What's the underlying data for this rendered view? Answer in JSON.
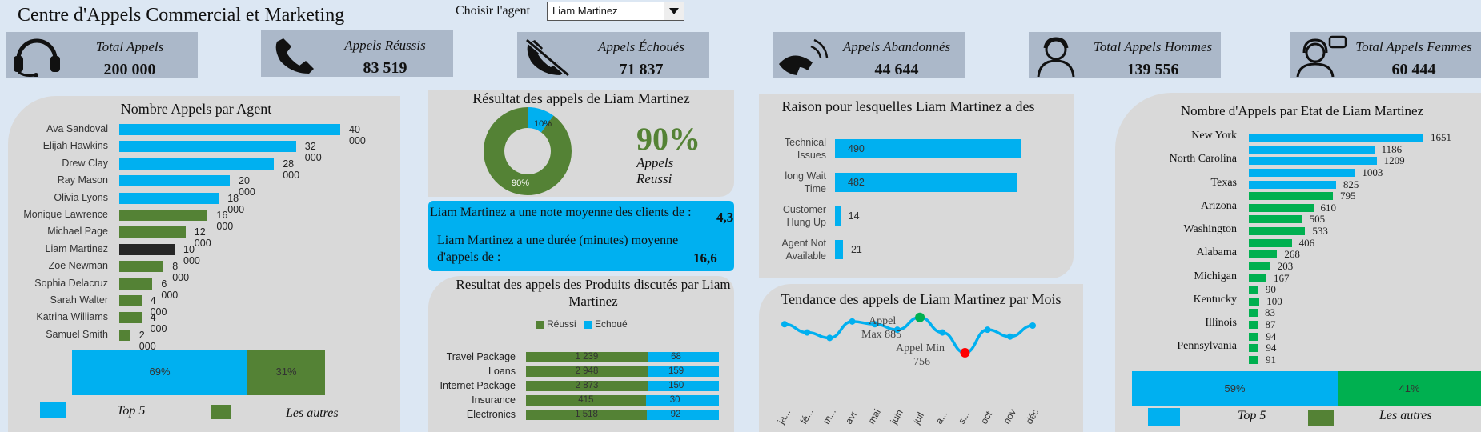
{
  "header": {
    "title": "Centre d'Appels Commercial et Marketing",
    "agent_label": "Choisir l'agent",
    "agent_value": "Liam Martinez"
  },
  "kpis": [
    {
      "label": "Total Appels",
      "value": "200 000",
      "icon": "headset-icon"
    },
    {
      "label": "Appels Réussis",
      "value": "83 519",
      "icon": "phone-icon"
    },
    {
      "label": "Appels Échoués",
      "value": "71 837",
      "icon": "phone-crossed-icon"
    },
    {
      "label": "Appels Abandonnés",
      "value": "44 644",
      "icon": "phone-ringing-icon"
    },
    {
      "label": "Total Appels Hommes",
      "value": "139 556",
      "icon": "male-user-icon"
    },
    {
      "label": "Total Appels Femmes",
      "value": "60 444",
      "icon": "female-agent-icon"
    }
  ],
  "colors": {
    "blue": "#00b0f0",
    "green": "#548235",
    "bright_green": "#00b050",
    "black": "#262626",
    "panel": "#d9d9d9",
    "kpi": "#abb8c9",
    "background": "#dce7f3",
    "min_marker": "#ff0000",
    "max_marker": "#00b050"
  },
  "summary": {
    "rating_text": "Liam Martinez a une note moyenne des clients de :",
    "rating_value": "4,3",
    "duration_text": "Liam Martinez a une durée (minutes) moyenne d'appels de :",
    "duration_value": "16,6"
  },
  "chart_data": [
    {
      "type": "bar",
      "orientation": "horizontal",
      "title": "Nombre Appels par Agent",
      "categories": [
        "Ava Sandoval",
        "Elijah Hawkins",
        "Drew Clay",
        "Ray Mason",
        "Olivia Lyons",
        "Monique Lawrence",
        "Michael Page",
        "Liam Martinez",
        "Zoe Newman",
        "Sophia Delacruz",
        "Sarah Walter",
        "Katrina Williams",
        "Samuel Smith"
      ],
      "values": [
        40000,
        32000,
        28000,
        20000,
        18000,
        16000,
        12000,
        10000,
        8000,
        6000,
        4000,
        4000,
        2000
      ],
      "labels": [
        "40 000",
        "32 000",
        "28 000",
        "20 000",
        "18 000",
        "16 000",
        "12 000",
        "10 000",
        "8 000",
        "6 000",
        "4 000",
        "4 000",
        "2 000"
      ],
      "bar_colors": [
        "blue",
        "blue",
        "blue",
        "blue",
        "blue",
        "green",
        "green",
        "black",
        "green",
        "green",
        "green",
        "green",
        "green"
      ],
      "share": {
        "values": [
          69,
          31
        ],
        "labels": [
          "69%",
          "31%"
        ],
        "legend": [
          "Top 5",
          "Les autres"
        ]
      }
    },
    {
      "type": "pie",
      "title": "Résultat des appels de Liam Martinez",
      "values": [
        90,
        10
      ],
      "labels": [
        "90%",
        "10%"
      ],
      "headline": "90%",
      "caption": "Appels Reussi"
    },
    {
      "type": "bar",
      "orientation": "horizontal",
      "stacked": true,
      "title": "Resultat des appels des Produits discutés par Liam Martinez",
      "categories": [
        "Travel Package",
        "Loans",
        "Internet Package",
        "Insurance",
        "Electronics"
      ],
      "series": [
        {
          "name": "Réussi",
          "values": [
            1239,
            2948,
            2873,
            415,
            1518
          ],
          "labels": [
            "1 239",
            "2 948",
            "2 873",
            "415",
            "1 518"
          ]
        },
        {
          "name": "Echoué",
          "values": [
            68,
            159,
            150,
            30,
            92
          ],
          "labels": [
            "68",
            "159",
            "150",
            "30",
            "92"
          ]
        }
      ],
      "legend_position": "top"
    },
    {
      "type": "bar",
      "orientation": "horizontal",
      "title": "Raison pour lesquelles Liam Martinez a des",
      "categories": [
        "Technical Issues",
        "long Wait Time",
        "Customer Hung Up",
        "Agent Not Available"
      ],
      "values": [
        490,
        482,
        14,
        21
      ]
    },
    {
      "type": "line",
      "title": "Tendance des appels de Liam Martinez par Mois",
      "x": [
        "ja...",
        "fé...",
        "m...",
        "avr",
        "mai",
        "juin",
        "juil",
        "a...",
        "s...",
        "oct",
        "nov",
        "déc"
      ],
      "values": [
        860,
        830,
        810,
        870,
        860,
        840,
        885,
        830,
        756,
        840,
        815,
        855
      ],
      "max_annotation": "Appel Max 885",
      "min_annotation": "Appel Min 756",
      "max_index": 6,
      "min_index": 8
    },
    {
      "type": "bar",
      "orientation": "horizontal",
      "title": "Nombre d'Appels par Etat de Liam Martinez",
      "state_labels": [
        "New York",
        "North Carolina",
        "Texas",
        "Arizona",
        "Washington",
        "Alabama",
        "Michigan",
        "Kentucky",
        "Illinois",
        "Pennsylvania"
      ],
      "values": [
        1651,
        1186,
        1209,
        1003,
        825,
        795,
        610,
        505,
        533,
        406,
        268,
        203,
        167,
        90,
        100,
        83,
        87,
        94,
        94,
        91
      ],
      "share": {
        "values": [
          59,
          41
        ],
        "labels": [
          "59%",
          "41%"
        ],
        "legend": [
          "Top 5",
          "Les autres"
        ]
      }
    }
  ]
}
